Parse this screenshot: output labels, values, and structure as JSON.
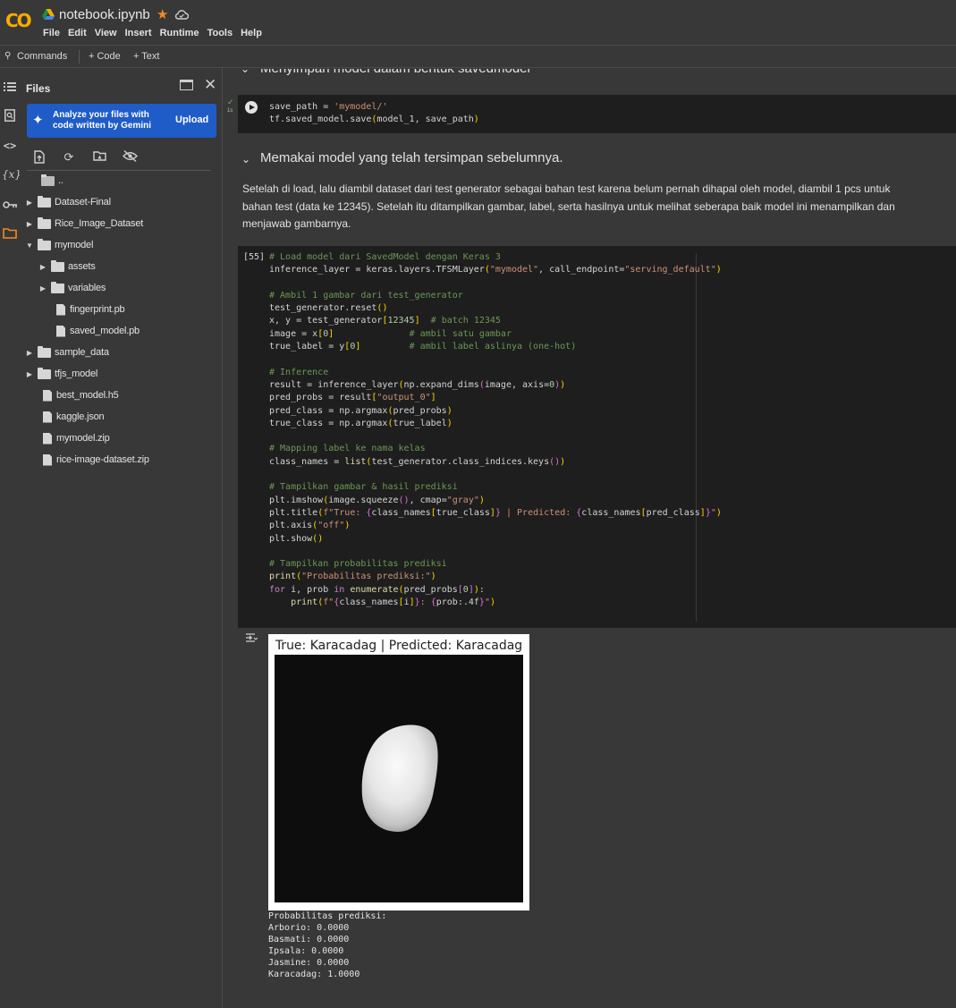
{
  "app": {
    "logo": "CO",
    "notebook_title": "notebook.ipynb",
    "menu": [
      "File",
      "Edit",
      "View",
      "Insert",
      "Runtime",
      "Tools",
      "Help"
    ]
  },
  "toolbar": {
    "commands_label": "Commands",
    "code_label": "+ Code",
    "text_label": "+ Text"
  },
  "files_panel": {
    "title": "Files",
    "gemini_text": "Analyze your files with code written by Gemini",
    "upload_label": "Upload",
    "tree": [
      {
        "label": "..",
        "type": "folder-open",
        "depth": 0
      },
      {
        "label": "Dataset-Final",
        "type": "folder",
        "depth": 0
      },
      {
        "label": "Rice_Image_Dataset",
        "type": "folder",
        "depth": 0
      },
      {
        "label": "mymodel",
        "type": "folder",
        "depth": 0,
        "expanded": true
      },
      {
        "label": "assets",
        "type": "folder",
        "depth": 1
      },
      {
        "label": "variables",
        "type": "folder",
        "depth": 1
      },
      {
        "label": "fingerprint.pb",
        "type": "file",
        "depth": 1
      },
      {
        "label": "saved_model.pb",
        "type": "file",
        "depth": 1
      },
      {
        "label": "sample_data",
        "type": "folder",
        "depth": 0
      },
      {
        "label": "tfjs_model",
        "type": "folder",
        "depth": 0
      },
      {
        "label": "best_model.h5",
        "type": "file",
        "depth": 0
      },
      {
        "label": "kaggle.json",
        "type": "file",
        "depth": 0
      },
      {
        "label": "mymodel.zip",
        "type": "file",
        "depth": 0
      },
      {
        "label": "rice-image-dataset.zip",
        "type": "file",
        "depth": 0
      }
    ]
  },
  "notebook": {
    "cut_heading": "Menyimpan model dalam bentuk savedmodel",
    "cell1": {
      "exec_time": "1s",
      "lines": [
        "save_path = 'mymodel/'",
        "tf.saved_model.save(model_1, save_path)"
      ]
    },
    "heading2": "Memakai model yang telah tersimpan sebelumnya.",
    "paragraph": "Setelah di load, lalu diambil dataset dari test generator sebagai bahan test karena belum pernah dihapal oleh model, diambil 1 pcs untuk bahan test (data ke 12345). Setelah itu ditampilkan gambar, label, serta hasilnya untuk melihat seberapa baik model ini menampilkan dan menjawab gambarnya.",
    "cell2": {
      "exec_count": "[55]",
      "lines": [
        "# Load model dari SavedModel dengan Keras 3",
        "inference_layer = keras.layers.TFSMLayer(\"mymodel\", call_endpoint=\"serving_default\")",
        "",
        "# Ambil 1 gambar dari test_generator",
        "test_generator.reset()",
        "x, y = test_generator[12345]  # batch 12345",
        "image = x[0]              # ambil satu gambar",
        "true_label = y[0]         # ambil label aslinya (one-hot)",
        "",
        "# Inference",
        "result = inference_layer(np.expand_dims(image, axis=0))",
        "pred_probs = result[\"output_0\"]",
        "pred_class = np.argmax(pred_probs)",
        "true_class = np.argmax(true_label)",
        "",
        "# Mapping label ke nama kelas",
        "class_names = list(test_generator.class_indices.keys())",
        "",
        "# Tampilkan gambar & hasil prediksi",
        "plt.imshow(image.squeeze(), cmap=\"gray\")",
        "plt.title(f\"True: {class_names[true_class]} | Predicted: {class_names[pred_class]}\")",
        "plt.axis(\"off\")",
        "plt.show()",
        "",
        "# Tampilkan probabilitas prediksi",
        "print(\"Probabilitas prediksi:\")",
        "for i, prob in enumerate(pred_probs[0]):",
        "    print(f\"{class_names[i]}: {prob:.4f}\")"
      ]
    },
    "output": {
      "plot_title": "True: Karacadag | Predicted: Karacadag",
      "print_lines": [
        "Probabilitas prediksi:",
        "Arborio: 0.0000",
        "Basmati: 0.0000",
        "Ipsala: 0.0000",
        "Jasmine: 0.0000",
        "Karacadag: 1.0000"
      ]
    }
  },
  "colors": {
    "accent_blue": "#1f5cc8",
    "logo_orange": "#f9ab00",
    "star": "#f28b20",
    "editor_bg": "#1e1e1e",
    "ui_bg": "#383838"
  }
}
